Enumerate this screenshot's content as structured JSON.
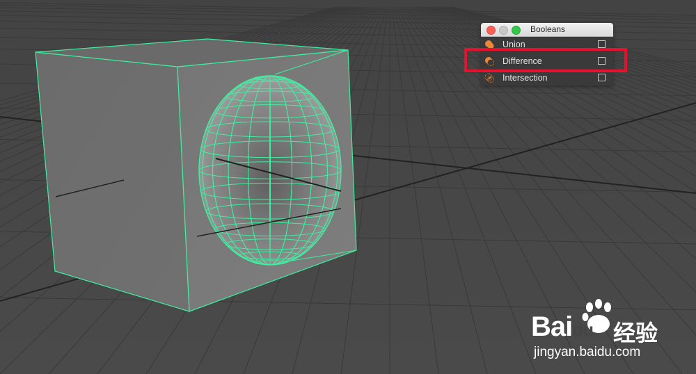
{
  "viewport": {
    "background": "#454545",
    "grid_color": "#3a3a3a",
    "axis_color": "#1f1f1f",
    "wireframe_color": "#3cf0a0",
    "cube_face_color": "#6e6e6e",
    "cube_side_color": "#7a7a7a"
  },
  "booleans_window": {
    "title": "Booleans",
    "items": [
      {
        "label": "Union",
        "icon": "union-icon",
        "checked": false
      },
      {
        "label": "Difference",
        "icon": "difference-icon",
        "checked": false
      },
      {
        "label": "Intersection",
        "icon": "intersection-icon",
        "checked": false
      }
    ],
    "highlight_color": "#e5112d",
    "highlighted_item": "Difference"
  },
  "watermark": {
    "brand_prefix": "Bai",
    "brand_suffix": "du",
    "cn_text": "经验",
    "url": "jingyan.baidu.com"
  }
}
